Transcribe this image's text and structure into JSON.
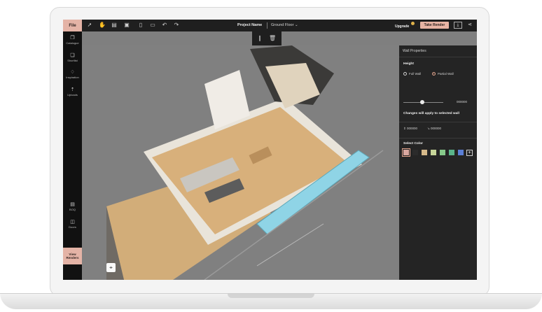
{
  "toolbar": {
    "file_label": "File",
    "project_name": "Project Name",
    "floor": "Ground Floor",
    "upgrade_label": "Upgrade",
    "take_render_label": "Take Render"
  },
  "sidebar": {
    "items": [
      {
        "label": "Catalogue",
        "icon": "catalogue-icon"
      },
      {
        "label": "Shortlist",
        "icon": "shortlist-icon"
      },
      {
        "label": "Inspiration",
        "icon": "lightbulb-icon"
      },
      {
        "label": "Uploads",
        "icon": "upload-icon"
      },
      {
        "label": "BOQ",
        "icon": "document-icon"
      },
      {
        "label": "Doors",
        "icon": "door-icon"
      }
    ],
    "view_renders_label_1": "View",
    "view_renders_label_2": "Renders"
  },
  "panel": {
    "title": "Wall Properties",
    "height_label": "Height",
    "option_full": "Full Wall",
    "option_partial": "Partial Wall",
    "selected_option": "Partial Wall",
    "slider_value": "000000",
    "slider_fraction": 0.48,
    "notice": "Changes will apply to selected wall",
    "thickness_value": "000000",
    "length_value": "000000",
    "select_color_label": "Select Color",
    "swatches": [
      "#d9a7a0",
      "#2b2b2b",
      "#d6b98a",
      "#c7d69a",
      "#86c98a",
      "#5ab48a",
      "#5b7fd6"
    ],
    "selected_swatch": 0
  },
  "colors": {
    "accent": "#e4b3a6",
    "topbar": "#1f1f1f",
    "panel": "#242424",
    "viewport": "#808080"
  }
}
